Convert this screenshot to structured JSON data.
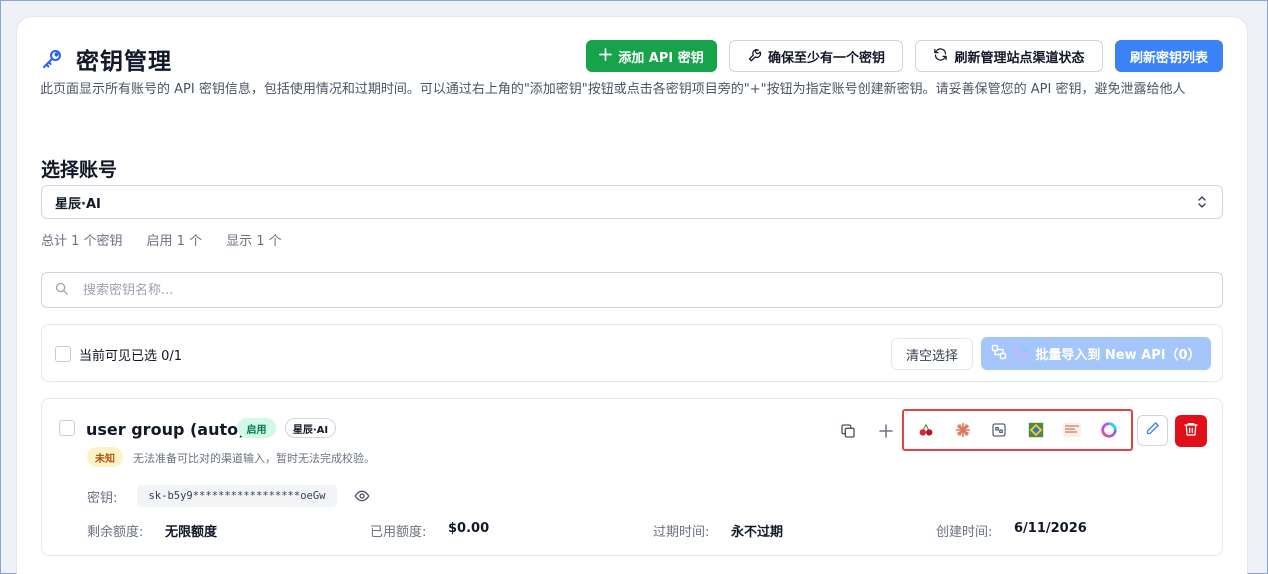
{
  "header": {
    "title": "密钥管理",
    "description": "此页面显示所有账号的 API 密钥信息，包括使用情况和过期时间。可以通过右上角的\"添加密钥\"按钮或点击各密钥项目旁的\"+\"按钮为指定账号创建新密钥。请妥善保管您的 API 密钥，避免泄露给他人",
    "buttons": {
      "add": "添加 API 密钥",
      "ensure": "确保至少有一个密钥",
      "refresh_status": "刷新管理站点渠道状态",
      "refresh_list": "刷新密钥列表"
    }
  },
  "account": {
    "section_title": "选择账号",
    "selected": "星辰·AI",
    "stats": {
      "total": "总计 1 个密钥",
      "enabled": "启用 1 个",
      "shown": "显示 1 个"
    }
  },
  "search": {
    "placeholder": "搜索密钥名称..."
  },
  "selection": {
    "label": "当前可见已选 0/1",
    "clear": "清空选择",
    "import": "批量导入到 New API（0）"
  },
  "key_item": {
    "name": "user group (auto)",
    "status_badge": "启用",
    "site_badge": "星辰·AI",
    "check_badge": "未知",
    "check_message": "无法准备可比对的渠道输入，暂时无法完成校验。",
    "key_label": "密钥:",
    "key_value": "sk-b5y9*****************oeGw",
    "remaining_label": "剩余额度:",
    "remaining_value": "无限额度",
    "used_label": "已用额度:",
    "used_value": "$0.00",
    "expire_label": "过期时间:",
    "expire_value": "永不过期",
    "created_label": "创建时间:",
    "created_value": "6/11/2026",
    "apps": [
      "cherry-studio-icon",
      "claude-burst-icon",
      "ai-box-icon",
      "diamond-app-icon",
      "claude-code-banner-icon",
      "new-api-ring-icon"
    ]
  },
  "colors": {
    "primary_green": "#16a34a",
    "primary_blue": "#3b82f6",
    "danger_red": "#e00f18",
    "highlight_border": "#e04545"
  }
}
